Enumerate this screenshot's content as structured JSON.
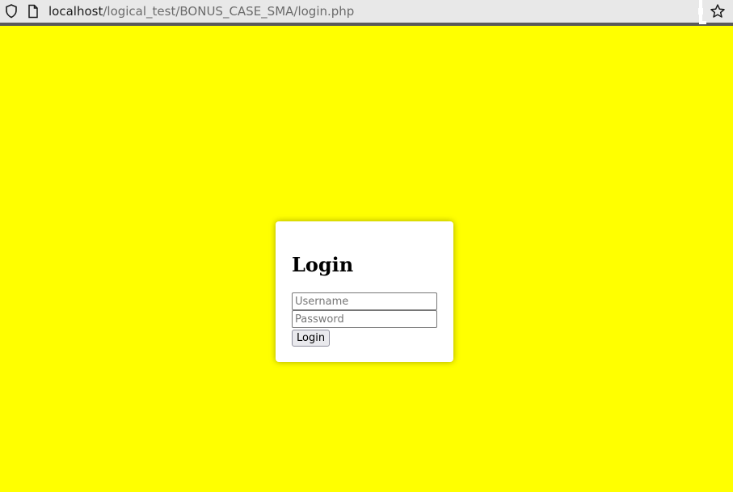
{
  "browser": {
    "url_host": "localhost",
    "url_path": "/logical_test/BONUS_CASE_SMA/login.php",
    "icons": {
      "left": [
        "shield-icon",
        "page-icon"
      ],
      "right": [
        "figure-icon",
        "star-icon"
      ]
    }
  },
  "page": {
    "background_color": "#ffff00"
  },
  "login": {
    "title": "Login",
    "username_placeholder": "Username",
    "password_placeholder": "Password",
    "button_label": "Login"
  }
}
